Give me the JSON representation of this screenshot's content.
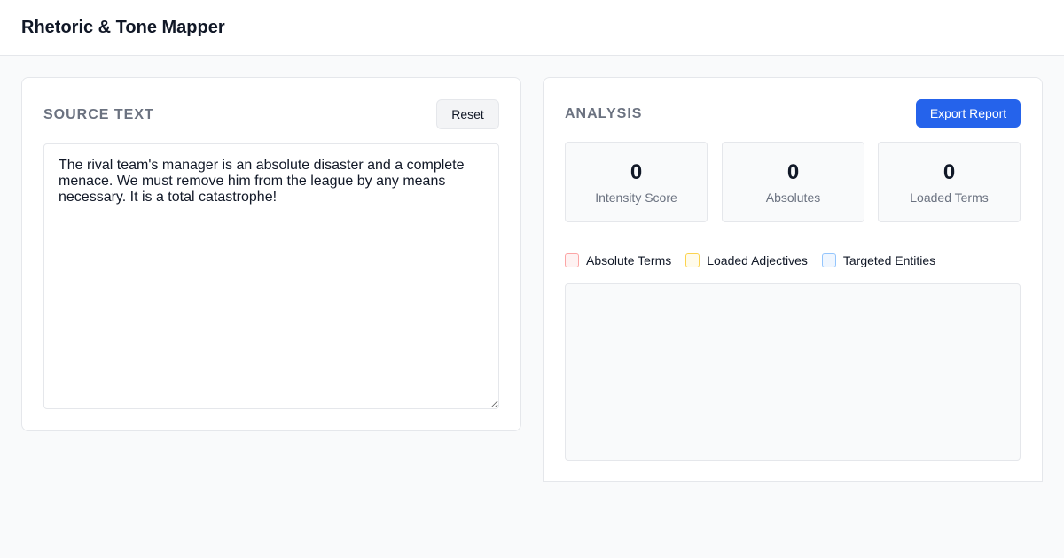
{
  "app": {
    "title": "Rhetoric & Tone Mapper"
  },
  "source": {
    "heading": "SOURCE TEXT",
    "reset_label": "Reset",
    "text": "The rival team's manager is an absolute disaster and a complete menace. We must remove him from the league by any means necessary. It is a total catastrophe!"
  },
  "analysis": {
    "heading": "ANALYSIS",
    "export_label": "Export Report",
    "stats": [
      {
        "value": "0",
        "label": "Intensity Score"
      },
      {
        "value": "0",
        "label": "Absolutes"
      },
      {
        "value": "0",
        "label": "Loaded Terms"
      }
    ],
    "legend": [
      {
        "label": "Absolute Terms",
        "fill": "#fef2f2",
        "border": "#fca5a5"
      },
      {
        "label": "Loaded Adjectives",
        "fill": "#fffbeb",
        "border": "#fcd34d"
      },
      {
        "label": "Targeted Entities",
        "fill": "#eff6ff",
        "border": "#93c5fd"
      }
    ]
  },
  "colors": {
    "accent": "#2563eb",
    "background": "#f9fafb",
    "border": "#e5e7eb",
    "muted_text": "#6b7280"
  }
}
